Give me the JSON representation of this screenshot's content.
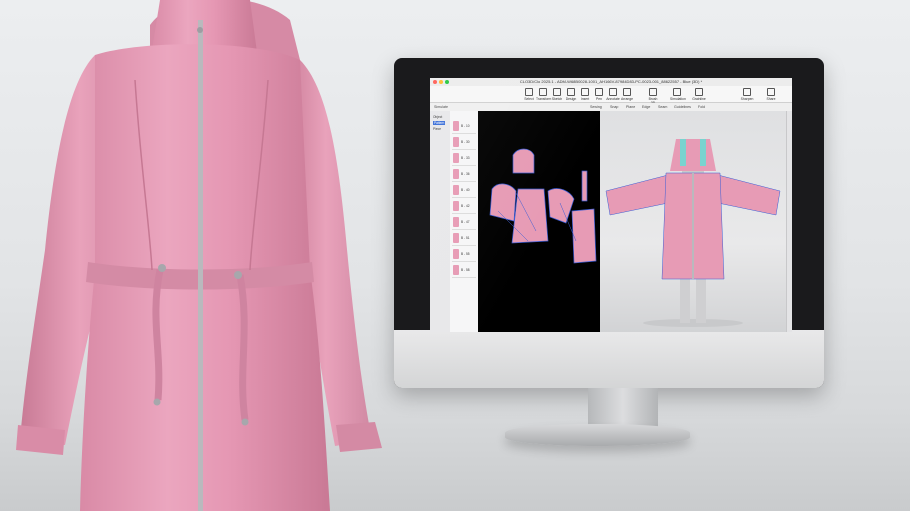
{
  "scene": {
    "subject": "pink hooded drawstring coat beside desktop monitor running 3D garment design software"
  },
  "app": {
    "window_title": "CLO3D/Clo 2025.1 - ADM-W68B0028-1001_AH166V-87984D83-PC-0023-001_88622557 - Blue (3D) *",
    "toolbar_items": [
      "Select",
      "Transform",
      "Sketch",
      "Design",
      "Insert",
      "Pen",
      "Annotate",
      "Arrange",
      "Brush 3D",
      "Simulation",
      "Grainline"
    ],
    "right_buttons": [
      "Sharpen",
      "Share"
    ],
    "subbar_left": "Simulate",
    "subbar_items": [
      "Sewing",
      "Snap",
      "Plane",
      "Edge",
      "Seam",
      "Guidelines",
      "Fold"
    ],
    "side_tabs": [
      "Object",
      "Pattern",
      "Piece"
    ],
    "list_items": [
      "B - 10",
      "B - 30",
      "B - 33",
      "B - 36",
      "B - 40",
      "B - 42",
      "B - 47",
      "B - 51",
      "B - 55",
      "B - 58"
    ]
  },
  "colors": {
    "garment_pink": "#e79bb5",
    "garment_shadow": "#c4708f",
    "zipper": "#b9b9bd",
    "pattern_blue": "#3b5dd6",
    "avatar_teal": "#79d3cf"
  }
}
